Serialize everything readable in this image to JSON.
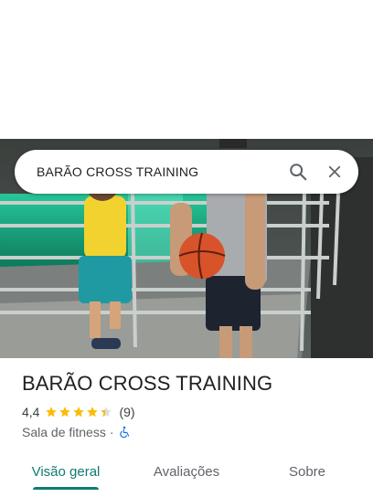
{
  "search": {
    "query": "BARÃO CROSS TRAINING"
  },
  "place": {
    "name": "BARÃO CROSS TRAINING",
    "rating": "4,4",
    "stars": 4.4,
    "review_count": "(9)",
    "category": "Sala de fitness",
    "separator": "·"
  },
  "tabs": [
    {
      "label": "Visão geral"
    },
    {
      "label": "Avaliações"
    },
    {
      "label": "Sobre"
    }
  ],
  "colors": {
    "accent": "#0f7b73",
    "star": "#fbbc04",
    "accessibility": "#1a73e8"
  },
  "icons": {
    "search": "search-icon",
    "close": "close-icon",
    "accessibility": "wheelchair-icon"
  }
}
